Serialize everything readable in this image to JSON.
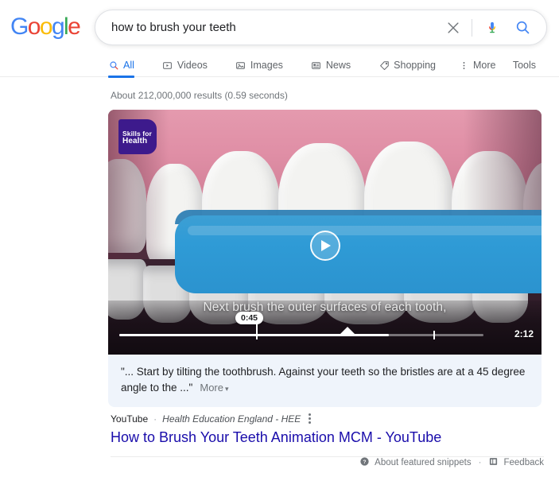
{
  "header": {
    "logo": {
      "text": "Google",
      "letters": [
        "G",
        "o",
        "o",
        "g",
        "l",
        "e"
      ]
    },
    "search": {
      "value": "how to brush your teeth",
      "placeholder": "Search",
      "clear_icon": "close-icon",
      "mic_icon": "microphone-icon",
      "search_icon": "search-icon"
    }
  },
  "nav": {
    "tabs": [
      {
        "label": "All",
        "icon": "search-icon",
        "active": true
      },
      {
        "label": "Videos",
        "icon": "video-icon",
        "active": false
      },
      {
        "label": "Images",
        "icon": "image-icon",
        "active": false
      },
      {
        "label": "News",
        "icon": "news-icon",
        "active": false
      },
      {
        "label": "Shopping",
        "icon": "tag-icon",
        "active": false
      },
      {
        "label": "More",
        "icon": "more-vertical-icon",
        "active": false
      }
    ],
    "tools_label": "Tools"
  },
  "results": {
    "count_text": "About 212,000,000 results (0.59 seconds)"
  },
  "featured_snippet": {
    "video": {
      "brand_badge_line1": "Skills for",
      "brand_badge_line2": "Health",
      "caption": "Next brush the outer surfaces of each tooth,",
      "current_time": "0:45",
      "total_time": "2:12",
      "play_icon": "play-icon"
    },
    "snippet_quote": "\"... Start by tilting the toothbrush. Against your teeth so the bristles are at a 45 degree angle to the ...\"",
    "more_label": "More"
  },
  "result": {
    "publisher": "YouTube",
    "separator": "·",
    "channel": "Health Education England - HEE",
    "title": "How to Brush Your Teeth Animation MCM - YouTube",
    "kebab_icon": "more-vertical-icon"
  },
  "footer": {
    "about_label": "About featured snippets",
    "about_icon": "help-circle-icon",
    "separator": "·",
    "feedback_label": "Feedback",
    "feedback_icon": "feedback-icon"
  },
  "colors": {
    "google_blue": "#4285F4",
    "google_red": "#EA4335",
    "google_yellow": "#FBBC05",
    "google_green": "#34A853",
    "link_blue": "#1a0dab",
    "active_tab": "#1a73e8",
    "snippet_bg": "#eff4fb",
    "brush_blue": "#2f9bd6",
    "gum_pink": "#e08fa6",
    "badge_purple": "#3d1a8c"
  }
}
